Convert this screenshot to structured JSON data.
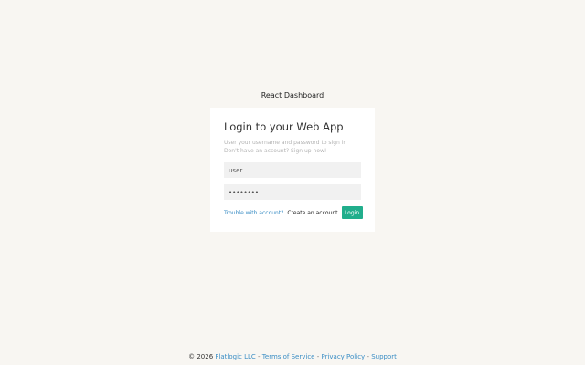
{
  "brand": {
    "title": "React Dashboard"
  },
  "login": {
    "title": "Login to your Web App",
    "subtitle_line1": "User your username and password to sign in",
    "subtitle_line2": "Don't have an account? Sign up now!",
    "username_value": "user",
    "password_value": "password",
    "trouble_link": "Trouble with account?",
    "create_account_label": "Create an account",
    "login_label": "Login"
  },
  "footer": {
    "copyright": "© 2026",
    "company_link": "Flatlogic LLC",
    "terms_link": "Terms of Service",
    "privacy_link": "Privacy Policy",
    "support_link": "Support",
    "separator": "-"
  },
  "colors": {
    "background": "#f8f6f2",
    "accent": "#21ae8c",
    "link": "#3b8ec5"
  }
}
